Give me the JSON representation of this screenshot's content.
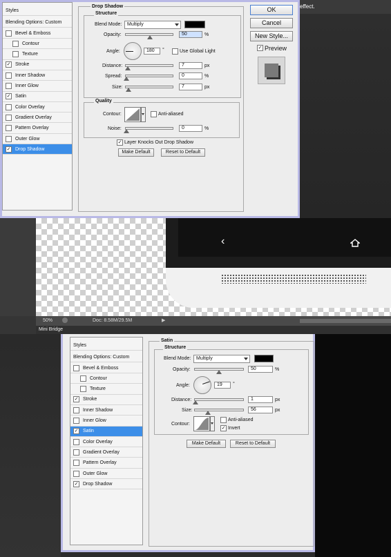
{
  "dialog1": {
    "styles_header": "Styles",
    "blending_options": "Blending Options: Custom",
    "items": [
      {
        "label": "Bevel & Emboss",
        "checked": false,
        "indent": false,
        "selected": false
      },
      {
        "label": "Contour",
        "checked": false,
        "indent": true,
        "selected": false
      },
      {
        "label": "Texture",
        "checked": false,
        "indent": true,
        "selected": false
      },
      {
        "label": "Stroke",
        "checked": true,
        "indent": false,
        "selected": false
      },
      {
        "label": "Inner Shadow",
        "checked": false,
        "indent": false,
        "selected": false
      },
      {
        "label": "Inner Glow",
        "checked": false,
        "indent": false,
        "selected": false
      },
      {
        "label": "Satin",
        "checked": true,
        "indent": false,
        "selected": false
      },
      {
        "label": "Color Overlay",
        "checked": false,
        "indent": false,
        "selected": false
      },
      {
        "label": "Gradient Overlay",
        "checked": false,
        "indent": false,
        "selected": false
      },
      {
        "label": "Pattern Overlay",
        "checked": false,
        "indent": false,
        "selected": false
      },
      {
        "label": "Outer Glow",
        "checked": false,
        "indent": false,
        "selected": false
      },
      {
        "label": "Drop Shadow",
        "checked": true,
        "indent": false,
        "selected": true
      }
    ],
    "section_title": "Drop Shadow",
    "structure_title": "Structure",
    "blend_mode_label": "Blend Mode:",
    "blend_mode_value": "Multiply",
    "opacity_label": "Opacity:",
    "opacity_value": "50",
    "opacity_fraction": 0.5,
    "percent": "%",
    "angle_label": "Angle:",
    "angle_value": "180",
    "degree": "°",
    "use_global_light": "Use Global Light",
    "distance_label": "Distance:",
    "distance_value": "7",
    "px": "px",
    "spread_label": "Spread:",
    "spread_value": "0",
    "size_label": "Size:",
    "size_value": "7",
    "quality_title": "Quality",
    "contour_label": "Contour:",
    "anti_aliased": "Anti-aliased",
    "noise_label": "Noise:",
    "noise_value": "0",
    "layer_knocks_out": "Layer Knocks Out Drop Shadow",
    "make_default": "Make Default",
    "reset_to_default": "Reset to Default",
    "ok": "OK",
    "cancel": "Cancel",
    "new_style": "New Style...",
    "preview": "Preview"
  },
  "top_strip_text": "effect.",
  "statusbar": {
    "zoom": "50%",
    "doc": "Doc: 8.58M/29.5M",
    "mini_bridge": "Mini Bridge"
  },
  "dialog2": {
    "styles_header": "Styles",
    "blending_options": "Blending Options: Custom",
    "items": [
      {
        "label": "Bevel & Emboss",
        "checked": false,
        "indent": false,
        "selected": false
      },
      {
        "label": "Contour",
        "checked": false,
        "indent": true,
        "selected": false
      },
      {
        "label": "Texture",
        "checked": false,
        "indent": true,
        "selected": false
      },
      {
        "label": "Stroke",
        "checked": true,
        "indent": false,
        "selected": false
      },
      {
        "label": "Inner Shadow",
        "checked": false,
        "indent": false,
        "selected": false
      },
      {
        "label": "Inner Glow",
        "checked": false,
        "indent": false,
        "selected": false
      },
      {
        "label": "Satin",
        "checked": true,
        "indent": false,
        "selected": true
      },
      {
        "label": "Color Overlay",
        "checked": false,
        "indent": false,
        "selected": false
      },
      {
        "label": "Gradient Overlay",
        "checked": false,
        "indent": false,
        "selected": false
      },
      {
        "label": "Pattern Overlay",
        "checked": false,
        "indent": false,
        "selected": false
      },
      {
        "label": "Outer Glow",
        "checked": false,
        "indent": false,
        "selected": false
      },
      {
        "label": "Drop Shadow",
        "checked": true,
        "indent": false,
        "selected": false
      }
    ],
    "section_title": "Satin",
    "structure_title": "Structure",
    "blend_mode_label": "Blend Mode:",
    "blend_mode_value": "Multiply",
    "opacity_label": "Opacity:",
    "opacity_value": "50",
    "percent": "%",
    "angle_label": "Angle:",
    "angle_value": "19",
    "degree": "°",
    "distance_label": "Distance:",
    "distance_value": "1",
    "px": "px",
    "size_label": "Size:",
    "size_value": "56",
    "contour_label": "Contour:",
    "anti_aliased": "Anti-aliased",
    "invert": "Invert",
    "make_default": "Make Default",
    "reset_to_default": "Reset to Default"
  },
  "colors": {
    "selection": "#3c8ee8",
    "dialog_border": "#b9b9e6",
    "shadow_color": "#000000"
  },
  "icons": [
    "back-arrow-icon",
    "home-icon",
    "checkmark-icon",
    "angle-dial-icon",
    "contour-curve-icon"
  ]
}
